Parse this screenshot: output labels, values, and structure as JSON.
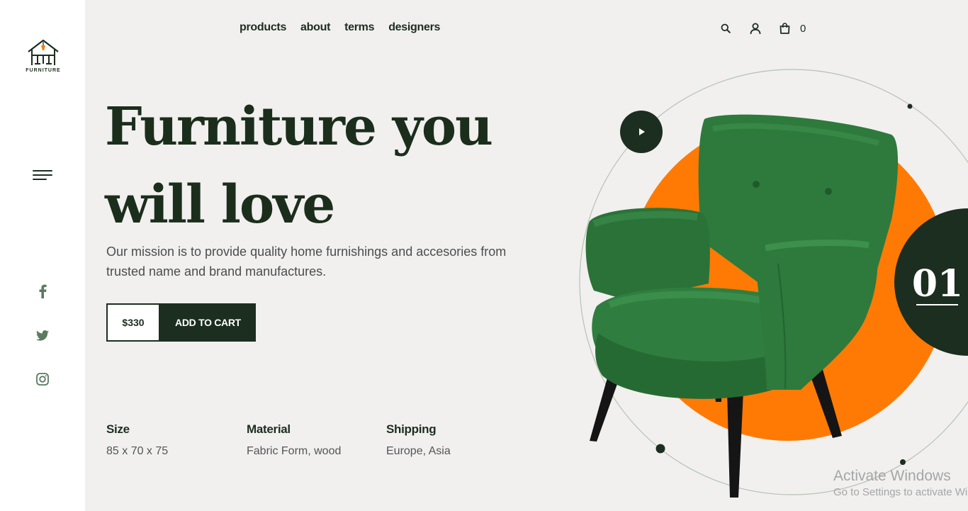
{
  "brand": {
    "name": "FURNITURE"
  },
  "nav": {
    "items": [
      "products",
      "about",
      "terms",
      "designers"
    ]
  },
  "header": {
    "cart_count": "0"
  },
  "hero": {
    "headline_line1": "Furniture you",
    "headline_line2": "will love",
    "mission": "Our mission is to provide quality home furnishings and accesories from trusted name and brand manufactures.",
    "price": "$330",
    "add_to_cart": "ADD TO CART",
    "slide_number": "01"
  },
  "specs": [
    {
      "label": "Size",
      "value": "85 x 70 x 75"
    },
    {
      "label": "Material",
      "value": "Fabric Form, wood"
    },
    {
      "label": "Shipping",
      "value": "Europe, Asia"
    }
  ],
  "watermark": {
    "title": "Activate Windows",
    "subtitle": "Go to Settings to activate Windows."
  },
  "colors": {
    "dark_green": "#1c2e1f",
    "orange": "#ff7a05",
    "chair_green": "#2f7a3e",
    "background": "#f1f0ef"
  },
  "icons": [
    "house-logo-icon",
    "hamburger-menu-icon",
    "facebook-icon",
    "twitter-icon",
    "instagram-icon",
    "search-icon",
    "user-icon",
    "shopping-bag-icon",
    "play-icon"
  ]
}
